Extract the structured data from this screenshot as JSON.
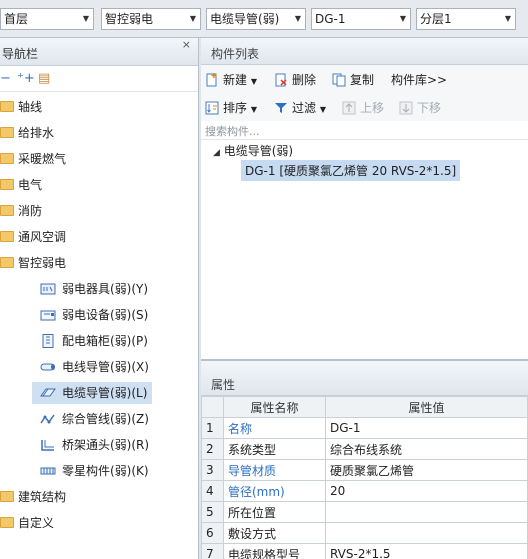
{
  "dropdowns": [
    {
      "value": "首层"
    },
    {
      "value": "智控弱电"
    },
    {
      "value": "电缆导管(弱)"
    },
    {
      "value": "DG-1"
    },
    {
      "value": "分层1"
    }
  ],
  "nav": {
    "title": "导航栏",
    "close_label": "×",
    "categories": [
      {
        "label": "轴线"
      },
      {
        "label": "给排水"
      },
      {
        "label": "采暖燃气"
      },
      {
        "label": "电气"
      },
      {
        "label": "消防"
      },
      {
        "label": "通风空调"
      },
      {
        "label": "智控弱电"
      }
    ],
    "subitems": [
      {
        "label": "弱电器具(弱)(Y)",
        "icon": "device-icon"
      },
      {
        "label": "弱电设备(弱)(S)",
        "icon": "equipment-icon"
      },
      {
        "label": "配电箱柜(弱)(P)",
        "icon": "cabinet-icon"
      },
      {
        "label": "电线导管(弱)(X)",
        "icon": "wire-conduit-icon"
      },
      {
        "label": "电缆导管(弱)(L)",
        "icon": "cable-conduit-icon"
      },
      {
        "label": "综合管线(弱)(Z)",
        "icon": "pipeline-icon"
      },
      {
        "label": "桥架通头(弱)(R)",
        "icon": "tray-joint-icon"
      },
      {
        "label": "零星构件(弱)(K)",
        "icon": "misc-component-icon"
      }
    ],
    "bottom_categories": [
      {
        "label": "建筑结构"
      },
      {
        "label": "自定义"
      }
    ],
    "selected_subitem": "电缆导管(弱)(L)"
  },
  "component_list": {
    "title": "构件列表",
    "toolbar": {
      "new_label": "新建",
      "delete_label": "删除",
      "copy_label": "复制",
      "library_label": "构件库>>",
      "sort_label": "排序",
      "filter_label": "过滤",
      "up_label": "上移",
      "down_label": "下移"
    },
    "search_placeholder": "搜索构件...",
    "group_label": "电缆导管(弱)",
    "selected_item": "DG-1 [硬质聚氯乙烯管 20 RVS-2*1.5]"
  },
  "properties": {
    "title": "属性",
    "col_name": "属性名称",
    "col_value": "属性值",
    "rows": [
      {
        "num": "1",
        "name": "名称",
        "value": "DG-1",
        "blue": true
      },
      {
        "num": "2",
        "name": "系统类型",
        "value": "综合布线系统",
        "blue": false
      },
      {
        "num": "3",
        "name": "导管材质",
        "value": "硬质聚氯乙烯管",
        "blue": true
      },
      {
        "num": "4",
        "name": "管径(mm)",
        "value": "20",
        "blue": true
      },
      {
        "num": "5",
        "name": "所在位置",
        "value": "",
        "blue": false
      },
      {
        "num": "6",
        "name": "敷设方式",
        "value": "",
        "blue": false
      },
      {
        "num": "7",
        "name": "电缆规格型号",
        "value": "RVS-2*1.5",
        "blue": false
      }
    ]
  },
  "colors": {
    "accent_blue": "#2d6fc2",
    "selected_bg": "#cfe0f3",
    "folder": "#f2c868"
  }
}
